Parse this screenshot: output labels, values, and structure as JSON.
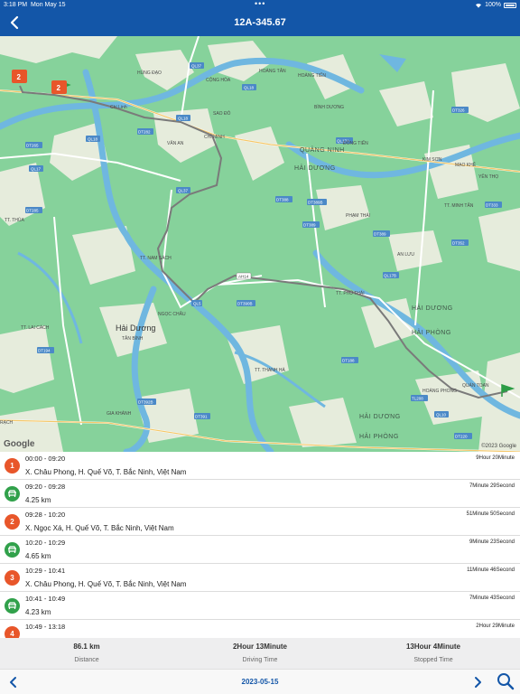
{
  "status_bar": {
    "time": "3:18 PM",
    "day": "Mon May 15",
    "battery": "100%"
  },
  "header": {
    "title": "12A-345.67",
    "back_icon": "chevron-left-icon"
  },
  "map": {
    "provider_logo": "Google",
    "copyright": "©2023 Google",
    "markers": [
      {
        "label": "2"
      },
      {
        "label": "2"
      }
    ],
    "place_labels": [
      "HÙNG ĐẠO",
      "CỘNG HÒA",
      "HOÀNG TÂN",
      "HOÀNG TIẾN",
      "Chí Linh",
      "SAO ĐỎ",
      "CHÍ MINH",
      "BÌNH DƯƠNG",
      "ĐỒNG TIẾN",
      "KIM SƠN",
      "MẠO KHÊ",
      "YÊN THỌ",
      "VĂN AN",
      "TT. MINH TÂN",
      "PHẠM THÁI",
      "AN LƯU",
      "TT. NAM SÁCH",
      "TT. PHÚ THÁI",
      "TT. THỦA",
      "TT. LAI CÁCH",
      "Hải Dương",
      "NGỌC CHÂU",
      "TÂN BÌNH",
      "TT. THANH HÀ",
      "GIA KHÁNH",
      "HOÀNG PHONG",
      "QUÁN TOAN",
      "RẠCH"
    ],
    "region_labels": [
      "QUẢNG NINH",
      "HẢI DƯƠNG",
      "HẢI DƯƠNG",
      "HẢI PHÒNG",
      "HẢI DƯƠNG",
      "HẢI PHÒNG"
    ],
    "road_badges": [
      "QL37",
      "QL18",
      "QL18",
      "QL18",
      "DT282",
      "DT265",
      "QL17",
      "DT285",
      "QL37",
      "DT388",
      "DT389",
      "DT389B",
      "DT389",
      "AH14",
      "QL17B",
      "DT390B",
      "QL5",
      "DT194",
      "DT392B",
      "DT391",
      "DT188",
      "TL208",
      "QL10",
      "DT220",
      "DT352",
      "DT333",
      "QL17A",
      "DT326"
    ]
  },
  "trips": [
    {
      "type": "stop",
      "index": "1",
      "time": "00:00 - 09:20",
      "detail": "X. Châu Phong, H. Quế Võ, T. Bắc Ninh, Việt Nam",
      "duration": "9Hour 20Minute"
    },
    {
      "type": "drive",
      "time": "09:20 - 09:28",
      "detail": "4.25 km",
      "duration": "7Minute 29Second"
    },
    {
      "type": "stop",
      "index": "2",
      "time": "09:28 - 10:20",
      "detail": "X. Ngọc Xá, H. Quế Võ, T. Bắc Ninh, Việt Nam",
      "duration": "51Minute 50Second"
    },
    {
      "type": "drive",
      "time": "10:20 - 10:29",
      "detail": "4.65 km",
      "duration": "9Minute 23Second"
    },
    {
      "type": "stop",
      "index": "3",
      "time": "10:29 - 10:41",
      "detail": "X. Châu Phong, H. Quế Võ, T. Bắc Ninh, Việt Nam",
      "duration": "11Minute 46Second"
    },
    {
      "type": "drive",
      "time": "10:41 - 10:49",
      "detail": "4.23 km",
      "duration": "7Minute 43Second"
    },
    {
      "type": "stop",
      "index": "4",
      "time": "10:49 - 13:18",
      "detail": "",
      "duration": "2Hour 29Minute"
    }
  ],
  "summary": {
    "distance": {
      "value": "86.1 km",
      "label": "Distance"
    },
    "driving": {
      "value": "2Hour 13Minute",
      "label": "Driving Time"
    },
    "stopped": {
      "value": "13Hour 4Minute",
      "label": "Stopped Time"
    }
  },
  "toolbar": {
    "date": "2023-05-15",
    "prev_icon": "chevron-left-icon",
    "next_icon": "chevron-right-icon",
    "search_icon": "search-icon"
  }
}
